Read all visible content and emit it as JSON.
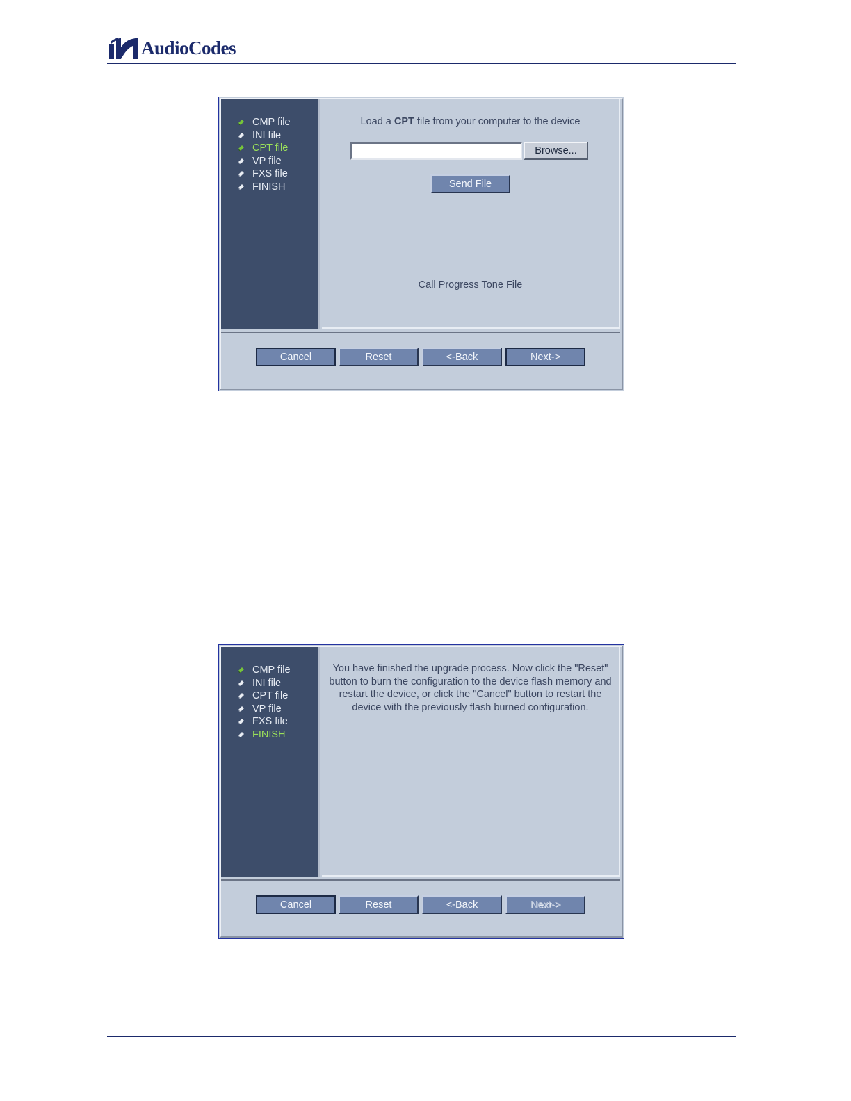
{
  "header": {
    "brand": "AudioCodes",
    "logo_icon": "audiocodes-logo-icon"
  },
  "wizard_cpt": {
    "sidebar": [
      {
        "label": "CMP file",
        "bullet": "green"
      },
      {
        "label": "INI file",
        "bullet": "white"
      },
      {
        "label": "CPT file",
        "bullet": "green",
        "active": true
      },
      {
        "label": "VP file",
        "bullet": "white"
      },
      {
        "label": "FXS file",
        "bullet": "white"
      },
      {
        "label": "FINISH",
        "bullet": "white"
      }
    ],
    "instruction_prefix": "Load a ",
    "instruction_bold": "CPT",
    "instruction_suffix": " file from your computer to the device",
    "file_value": "",
    "browse_label": "Browse...",
    "send_label": "Send File",
    "caption": "Call Progress Tone File",
    "buttons": {
      "cancel": "Cancel",
      "reset": "Reset",
      "back": "<-Back",
      "next": "Next->"
    }
  },
  "wizard_finish": {
    "sidebar": [
      {
        "label": "CMP file",
        "bullet": "green"
      },
      {
        "label": "INI file",
        "bullet": "white"
      },
      {
        "label": "CPT file",
        "bullet": "white"
      },
      {
        "label": "VP file",
        "bullet": "white"
      },
      {
        "label": "FXS file",
        "bullet": "white"
      },
      {
        "label": "FINISH",
        "bullet": "white",
        "active": true
      }
    ],
    "message": "You have finished the upgrade process. Now click the \"Reset\" button to burn the configuration to the device flash memory and restart the device, or click the \"Cancel\" button to restart the device with the previously flash burned configuration.",
    "buttons": {
      "cancel": "Cancel",
      "reset": "Reset",
      "back": "<-Back",
      "next": "Next->",
      "next_disabled": true
    }
  },
  "colors": {
    "sidebar_bg": "#3d4d6a",
    "active_item": "#9be05a",
    "panel_bg": "#c3cddb",
    "button_bg": "#7085ad",
    "brand": "#1b2a6b"
  }
}
